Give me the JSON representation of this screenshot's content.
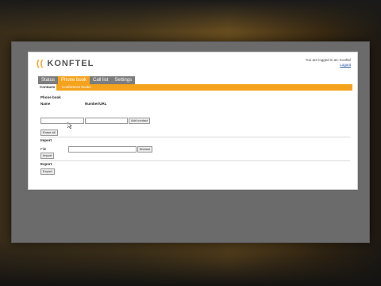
{
  "header": {
    "logo_text": "KONFTEL",
    "logo_bracket": "((",
    "login_text": "You are logged in as: Konftel",
    "logout_label": "Logout"
  },
  "nav": {
    "tabs": [
      {
        "label": "Status",
        "active": false
      },
      {
        "label": "Phone book",
        "active": true
      },
      {
        "label": "Call list",
        "active": false
      },
      {
        "label": "Settings",
        "active": false
      }
    ]
  },
  "subnav": {
    "tabs": [
      {
        "label": "Contacts",
        "active": true
      },
      {
        "label": "Conference books",
        "active": false
      }
    ]
  },
  "phonebook": {
    "section_title": "Phone book",
    "name_header": "Name",
    "number_header": "Number/URL",
    "name_value": "",
    "number_value": "",
    "add_contact_label": "Add contact",
    "erase_all_label": "Erase all"
  },
  "import": {
    "section_title": "Import",
    "file_label": "File",
    "file_value": "",
    "browse_label": "Browse",
    "import_button_label": "Import"
  },
  "export": {
    "section_title": "Export",
    "export_button_label": "Export"
  },
  "colors": {
    "accent": "#f5a31c",
    "nav_gray": "#7d7d7d"
  }
}
